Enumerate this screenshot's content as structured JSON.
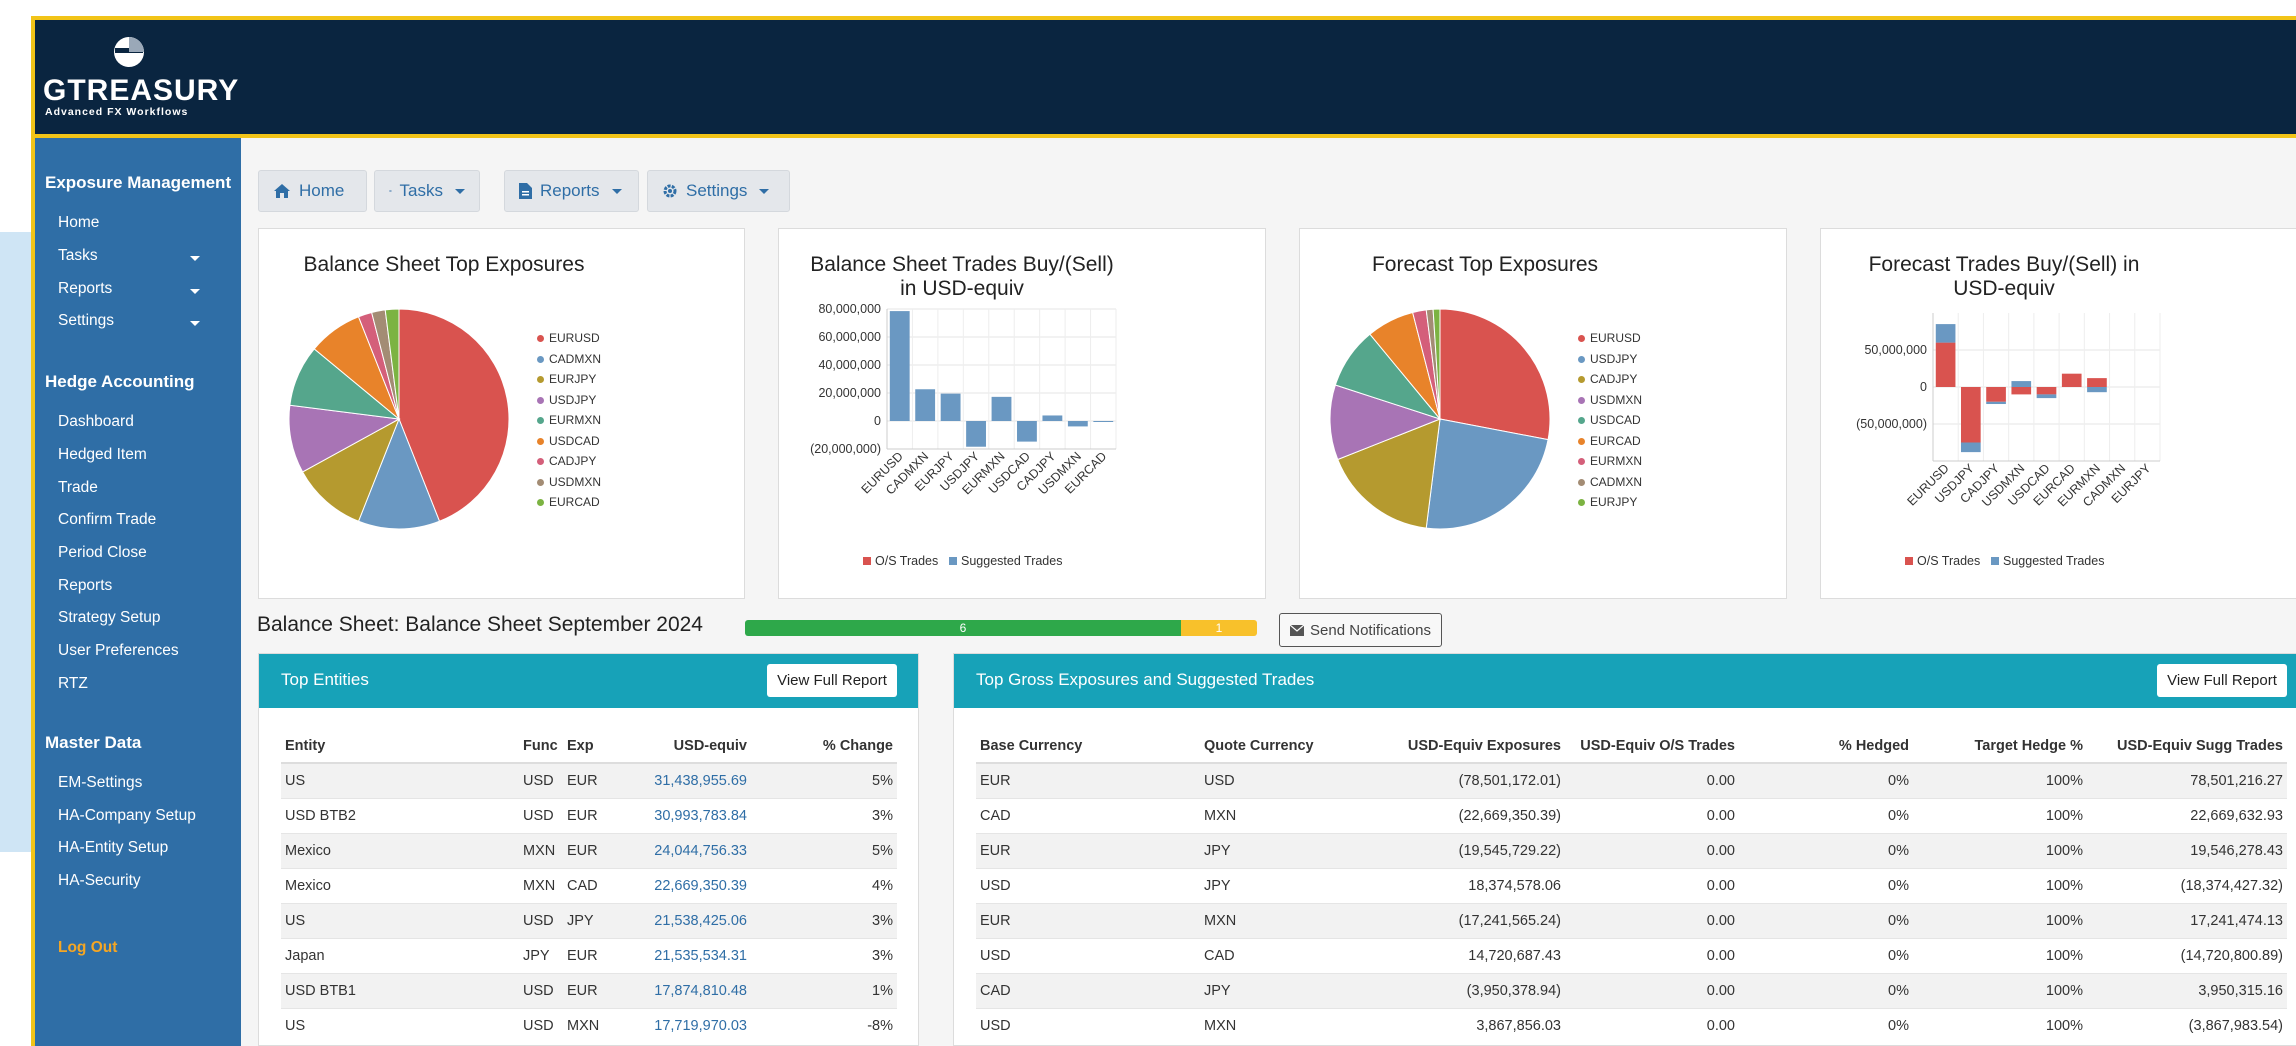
{
  "brand": {
    "name": "GTREASURY",
    "tagline": "Advanced FX Workflows"
  },
  "sidebar": {
    "sections": [
      {
        "title": "Exposure Management",
        "items": [
          {
            "label": "Home",
            "caret": false
          },
          {
            "label": "Tasks",
            "caret": true
          },
          {
            "label": "Reports",
            "caret": true
          },
          {
            "label": "Settings",
            "caret": true
          }
        ]
      },
      {
        "title": "Hedge Accounting",
        "items": [
          {
            "label": "Dashboard"
          },
          {
            "label": "Hedged Item"
          },
          {
            "label": "Trade"
          },
          {
            "label": "Confirm Trade"
          },
          {
            "label": "Period Close"
          },
          {
            "label": "Reports"
          },
          {
            "label": "Strategy Setup"
          },
          {
            "label": "User Preferences"
          },
          {
            "label": "RTZ"
          }
        ]
      },
      {
        "title": "Master Data",
        "items": [
          {
            "label": "EM-Settings"
          },
          {
            "label": "HA-Company Setup"
          },
          {
            "label": "HA-Entity Setup"
          },
          {
            "label": "HA-Security"
          }
        ]
      }
    ],
    "logout": "Log Out"
  },
  "toolbar": {
    "home": "Home",
    "tasks": "Tasks",
    "reports": "Reports",
    "settings": "Settings"
  },
  "cards": {
    "bs_top": {
      "title": "Balance Sheet Top Exposures"
    },
    "bs_trades": {
      "title_line1": "Balance Sheet Trades Buy/(Sell)",
      "title_line2": "in USD-equiv"
    },
    "fc_top": {
      "title": "Forecast Top Exposures"
    },
    "fc_trades": {
      "title_line1": "Forecast Trades Buy/(Sell) in",
      "title_line2": "USD-equiv"
    }
  },
  "chart_data": [
    {
      "type": "pie",
      "title": "Balance Sheet Top Exposures",
      "labels": [
        "EURUSD",
        "CADMXN",
        "EURJPY",
        "USDJPY",
        "EURMXN",
        "USDCAD",
        "CADJPY",
        "USDMXN",
        "EURCAD"
      ],
      "values": [
        44,
        12,
        11,
        10,
        9,
        8,
        2,
        2,
        2
      ],
      "colors": [
        "#d9534f",
        "#6a98c2",
        "#b59a2f",
        "#a874b5",
        "#55a68c",
        "#e8832a",
        "#d45f7a",
        "#a38c74",
        "#7cb342"
      ],
      "legend": "right"
    },
    {
      "type": "bar",
      "title": "Balance Sheet Trades Buy/(Sell) in USD-equiv",
      "categories": [
        "EURUSD",
        "CADMXN",
        "EURJPY",
        "USDJPY",
        "EURMXN",
        "USDCAD",
        "CADJPY",
        "USDMXN",
        "EURCAD"
      ],
      "series": [
        {
          "name": "O/S Trades",
          "values": [
            0,
            0,
            0,
            0,
            0,
            0,
            0,
            0,
            0
          ],
          "color": "#d9534f"
        },
        {
          "name": "Suggested Trades",
          "values": [
            78501216,
            22669633,
            19546278,
            -18374427,
            17241474,
            -14720801,
            3950315,
            -3867984,
            -500000
          ],
          "color": "#6a98c2"
        }
      ],
      "yticks": [
        "80,000,000",
        "60,000,000",
        "40,000,000",
        "20,000,000",
        "0",
        "(20,000,000)"
      ],
      "ylim": [
        -20000000,
        80000000
      ],
      "legend": "bottom"
    },
    {
      "type": "pie",
      "title": "Forecast Top Exposures",
      "labels": [
        "EURUSD",
        "USDJPY",
        "CADJPY",
        "USDMXN",
        "USDCAD",
        "EURCAD",
        "EURMXN",
        "CADMXN",
        "EURJPY"
      ],
      "values": [
        28,
        24,
        17,
        11,
        9,
        7,
        2,
        1,
        1
      ],
      "colors": [
        "#d9534f",
        "#6a98c2",
        "#b59a2f",
        "#a874b5",
        "#55a68c",
        "#e8832a",
        "#d45f7a",
        "#a38c74",
        "#7cb342"
      ],
      "legend": "right"
    },
    {
      "type": "bar",
      "title": "Forecast Trades Buy/(Sell) in USD-equiv",
      "categories": [
        "EURUSD",
        "USDJPY",
        "CADJPY",
        "USDMXN",
        "USDCAD",
        "EURCAD",
        "EURMXN",
        "CADMXN",
        "EURJPY"
      ],
      "series": [
        {
          "name": "O/S Trades",
          "values": [
            60000000,
            -75000000,
            -20000000,
            -10000000,
            -10000000,
            18000000,
            12000000,
            0,
            0
          ],
          "color": "#d9534f"
        },
        {
          "name": "Suggested Trades",
          "values": [
            25000000,
            -13000000,
            -3000000,
            8000000,
            -5000000,
            0,
            -7000000,
            0,
            0
          ],
          "color": "#6a98c2"
        }
      ],
      "yticks": [
        "50,000,000",
        "0",
        "(50,000,000)"
      ],
      "ylim": [
        -100000000,
        100000000
      ],
      "legend": "bottom"
    }
  ],
  "balance_sheet": {
    "title": "Balance Sheet: Balance Sheet September 2024",
    "progress_green": 6,
    "progress_yellow": 1,
    "notify_label": "Send Notifications"
  },
  "top_entities": {
    "title": "Top Entities",
    "button": "View Full Report",
    "columns": [
      "Entity",
      "Func",
      "Exp",
      "USD-equiv",
      "% Change"
    ],
    "rows": [
      [
        "US",
        "USD",
        "EUR",
        "31,438,955.69",
        "5%"
      ],
      [
        "USD BTB2",
        "USD",
        "EUR",
        "30,993,783.84",
        "3%"
      ],
      [
        "Mexico",
        "MXN",
        "EUR",
        "24,044,756.33",
        "5%"
      ],
      [
        "Mexico",
        "MXN",
        "CAD",
        "22,669,350.39",
        "4%"
      ],
      [
        "US",
        "USD",
        "JPY",
        "21,538,425.06",
        "3%"
      ],
      [
        "Japan",
        "JPY",
        "EUR",
        "21,535,534.31",
        "3%"
      ],
      [
        "USD BTB1",
        "USD",
        "EUR",
        "17,874,810.48",
        "1%"
      ],
      [
        "US",
        "USD",
        "MXN",
        "17,719,970.03",
        "-8%"
      ]
    ]
  },
  "top_gross": {
    "title": "Top Gross Exposures and Suggested Trades",
    "button": "View Full Report",
    "columns": [
      "Base Currency",
      "Quote Currency",
      "USD-Equiv Exposures",
      "USD-Equiv O/S Trades",
      "% Hedged",
      "Target Hedge %",
      "USD-Equiv Sugg Trades"
    ],
    "rows": [
      [
        "EUR",
        "USD",
        "(78,501,172.01)",
        "0.00",
        "0%",
        "100%",
        "78,501,216.27"
      ],
      [
        "CAD",
        "MXN",
        "(22,669,350.39)",
        "0.00",
        "0%",
        "100%",
        "22,669,632.93"
      ],
      [
        "EUR",
        "JPY",
        "(19,545,729.22)",
        "0.00",
        "0%",
        "100%",
        "19,546,278.43"
      ],
      [
        "USD",
        "JPY",
        "18,374,578.06",
        "0.00",
        "0%",
        "100%",
        "(18,374,427.32)"
      ],
      [
        "EUR",
        "MXN",
        "(17,241,565.24)",
        "0.00",
        "0%",
        "100%",
        "17,241,474.13"
      ],
      [
        "USD",
        "CAD",
        "14,720,687.43",
        "0.00",
        "0%",
        "100%",
        "(14,720,800.89)"
      ],
      [
        "CAD",
        "JPY",
        "(3,950,378.94)",
        "0.00",
        "0%",
        "100%",
        "3,950,315.16"
      ],
      [
        "USD",
        "MXN",
        "3,867,856.03",
        "0.00",
        "0%",
        "100%",
        "(3,867,983.54)"
      ]
    ]
  }
}
